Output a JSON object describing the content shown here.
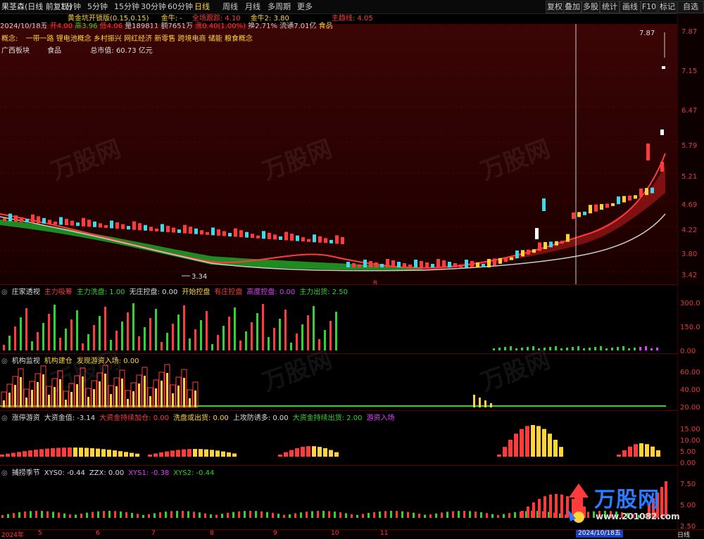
{
  "toolbar": {
    "stock_name": "果茎森(日线 前复权)",
    "timeframes": [
      "1分钟",
      "5分钟",
      "15分钟",
      "30分钟",
      "60分钟",
      "日线",
      "周线",
      "月线",
      "多周期",
      "更多"
    ],
    "active_timeframe": "日线",
    "buttons": [
      "复权",
      "叠加",
      "多股",
      "统计",
      "画线",
      "F10",
      "标记",
      "自选"
    ]
  },
  "indicator_line": {
    "name": "黄金坑开锁版(0.15,0.15)",
    "items": [
      {
        "text": "金牛: -",
        "color": "#ffd43b"
      },
      {
        "text": "全场跟踪: 4.10",
        "color": "#ff3b3b"
      },
      {
        "text": "金牛2: 3.80",
        "color": "#ffd43b"
      },
      {
        "text": "主趋线: 4.05",
        "color": "#ff3b3b"
      }
    ]
  },
  "quote_line": {
    "date": "2024/10/18五",
    "open": "开4.00",
    "high": "高3.96",
    "low": "低4.06",
    "volume": "量189811",
    "amount": "额7651万",
    "change": "涨0.40(1.00%)",
    "turnover": "换2.71%",
    "float_cap": "流通7.01亿",
    "sector": "食品"
  },
  "concepts": {
    "label": "概念:",
    "items": "一带一路 锂电池概念 乡村振兴 网红经济 新零售 跨境电商 储能 粮食概念"
  },
  "region_line": {
    "region": "广西板块",
    "industry": "食品",
    "mcap_label": "总市值:",
    "mcap": "60.73 亿元"
  },
  "price_axis": [
    "7.87",
    "7.15",
    "6.47",
    "5.79",
    "5.21",
    "4.69",
    "4.22",
    "3.80",
    "3.42"
  ],
  "annotations": {
    "high_mark": "7.87",
    "low_mark": "3.34",
    "peak_label": "8"
  },
  "panels": [
    {
      "title": "庄家透视",
      "items": [
        {
          "text": "主力吸筹",
          "color": "#ff3b3b"
        },
        {
          "text": "主力洗盘: 1.00",
          "color": "#32d232"
        },
        {
          "text": "无庄控盘: 0.00",
          "color": "#dddddd"
        },
        {
          "text": "开始控盘",
          "color": "#ffd43b"
        },
        {
          "text": "有庄控盘",
          "color": "#ff3b3b"
        },
        {
          "text": "高度控盘: 0.00",
          "color": "#e040fb"
        },
        {
          "text": "主力出货: 2.50",
          "color": "#32d232"
        }
      ],
      "ticks": [
        "300.0",
        "150.0",
        "0.00"
      ]
    },
    {
      "title": "机构监视",
      "items": [
        {
          "text": "机构建仓",
          "color": "#ffd43b"
        },
        {
          "text": "发现游资入场: 0.00",
          "color": "#ffd43b"
        }
      ],
      "ticks": [
        "60.00",
        "40.00",
        "20.00"
      ]
    },
    {
      "title": "涨停游资",
      "items": [
        {
          "text": "大资金值: -3.14",
          "color": "#dddddd"
        },
        {
          "text": "大资金持续加仓: 0.00",
          "color": "#ff3b3b"
        },
        {
          "text": "洗盘或出货: 0.00",
          "color": "#ffd43b"
        },
        {
          "text": "上攻防诱多: 0.00",
          "color": "#dddddd"
        },
        {
          "text": "大资金持续出货: 2.00",
          "color": "#32d232"
        },
        {
          "text": "游资入场",
          "color": "#e040fb"
        }
      ],
      "ticks": [
        "15.00",
        "10.00",
        "5.00",
        "0.00"
      ]
    },
    {
      "title": "捕捞季节",
      "items": [
        {
          "text": "XYS0: -0.44",
          "color": "#dddddd"
        },
        {
          "text": "ZZX: 0.00",
          "color": "#dddddd"
        },
        {
          "text": "XYS1: -0.38",
          "color": "#e040fb"
        },
        {
          "text": "XYS2: -0.44",
          "color": "#32d232"
        }
      ],
      "ticks": [
        "7.50",
        "5.00",
        "2.50"
      ]
    }
  ],
  "date_axis": {
    "labels": [
      "2024年",
      "5",
      "6",
      "7",
      "8",
      "9",
      "10",
      "11"
    ],
    "cursor_date": "2024/10/18五",
    "cycle": "日线"
  },
  "watermark": {
    "text": "万股网",
    "site": "www.201082.com"
  },
  "colors": {
    "up": "#ff3b3b",
    "down": "#32d232",
    "yellow": "#ffd43b",
    "cyan": "#3fd9e8",
    "magenta": "#e040fb"
  }
}
